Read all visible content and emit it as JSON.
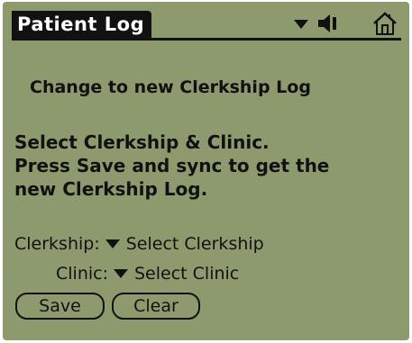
{
  "header": {
    "title": "Patient Log"
  },
  "icons": {
    "menu": "chevron-down-icon",
    "speaker": "speaker-icon",
    "home": "home-icon"
  },
  "main": {
    "heading": "Change to new Clerkship Log",
    "instructions": [
      "Select Clerkship & Clinic.",
      "Press Save and sync to get the",
      "new Clerkship Log."
    ],
    "clerkship": {
      "label": "Clerkship:",
      "value": "Select Clerkship"
    },
    "clinic": {
      "label": "Clinic:",
      "value": "Select Clinic"
    }
  },
  "buttons": {
    "save": "Save",
    "clear": "Clear"
  },
  "colors": {
    "background": "#8d9a6e",
    "ink": "#111111"
  }
}
